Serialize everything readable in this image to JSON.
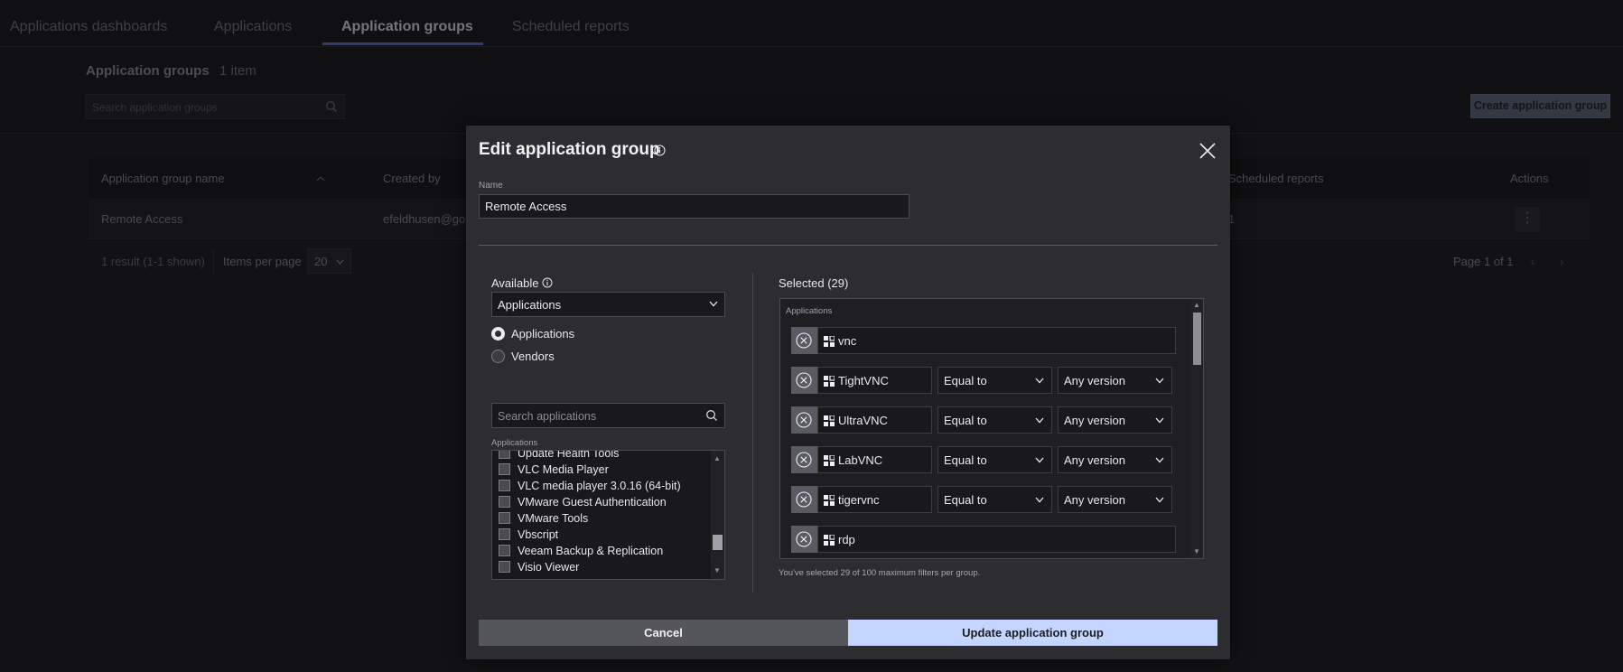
{
  "nav": {
    "tabs": [
      {
        "label": "Applications dashboards"
      },
      {
        "label": "Applications"
      },
      {
        "label": "Application groups"
      },
      {
        "label": "Scheduled reports"
      }
    ]
  },
  "page": {
    "title": "Application groups",
    "count": "1 item",
    "search_placeholder": "Search application groups",
    "create_button": "Create application group"
  },
  "table": {
    "headers": {
      "name": "Application group name",
      "created_by": "Created by",
      "scheduled_reports": "Scheduled reports",
      "actions": "Actions"
    },
    "row": {
      "name": "Remote Access",
      "created_by": "efeldhusen@gon",
      "scheduled_reports": "1"
    },
    "result_text": "1 result (1-1 shown)",
    "items_per_page_label": "Items per page",
    "items_per_page_value": "20",
    "page_text": "Page 1 of 1"
  },
  "modal": {
    "title": "Edit application group",
    "name_label": "Name",
    "name_value": "Remote Access",
    "available_label": "Available",
    "available_dropdown": "Applications",
    "radio_applications": "Applications",
    "radio_vendors": "Vendors",
    "radio_selected": "Applications",
    "search_placeholder": "Search applications",
    "applications_caption": "Applications",
    "available_items": [
      "Update Health Tools",
      "VLC Media Player",
      "VLC media player 3.0.16 (64-bit)",
      "VMware Guest Authentication",
      "VMware Tools",
      "Vbscript",
      "Veeam Backup & Replication",
      "Visio Viewer"
    ],
    "selected_label": "Selected (29)",
    "selected_caption": "Applications",
    "selected_items": [
      {
        "name": "vnc"
      },
      {
        "name": "TightVNC",
        "operator": "Equal to",
        "version": "Any version"
      },
      {
        "name": "UltraVNC",
        "operator": "Equal to",
        "version": "Any version"
      },
      {
        "name": "LabVNC",
        "operator": "Equal to",
        "version": "Any version"
      },
      {
        "name": "tigervnc",
        "operator": "Equal to",
        "version": "Any version"
      },
      {
        "name": "rdp"
      }
    ],
    "limit_note": "You've selected 29 of 100 maximum filters per group.",
    "cancel_label": "Cancel",
    "update_label": "Update application group"
  }
}
